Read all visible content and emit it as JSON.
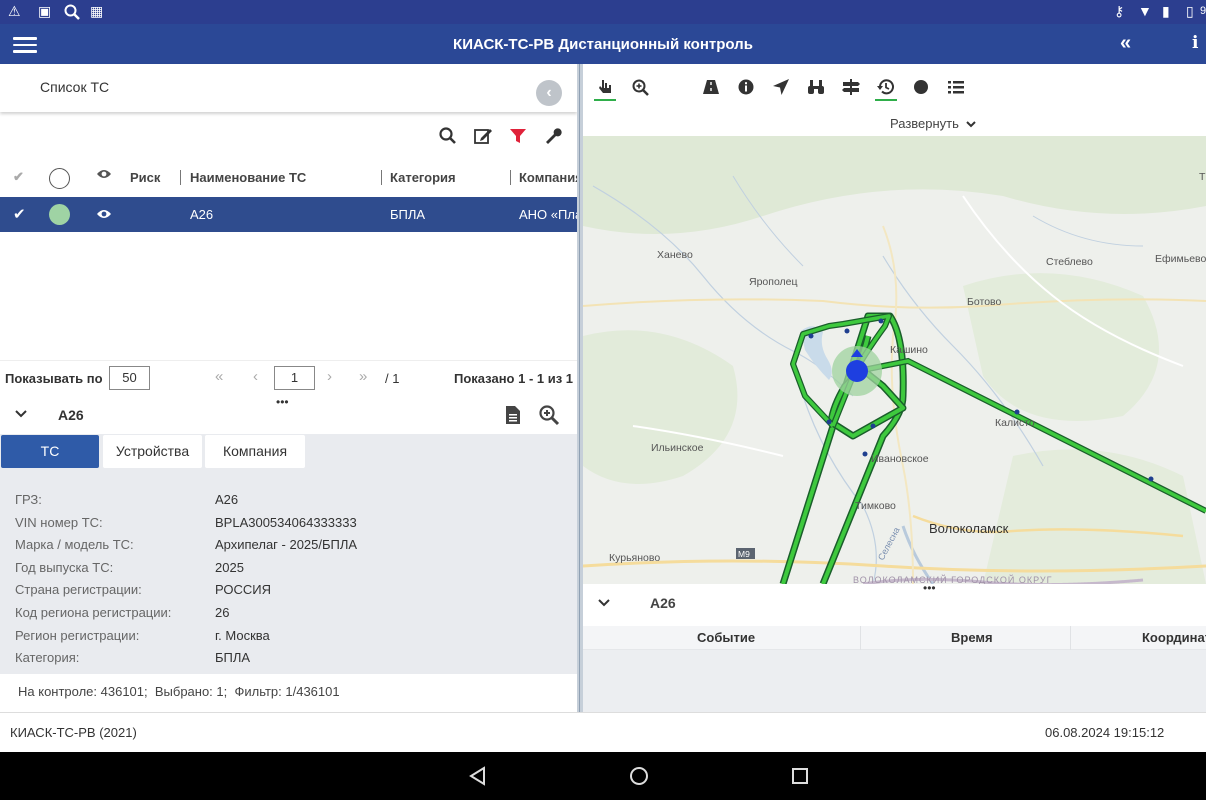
{
  "app": {
    "title": "КИАСК-ТС-РВ Дистанционный контроль",
    "colors": {
      "header": "#2b4896",
      "selected_row": "#2f4c8e",
      "accent_green": "#2fae4a",
      "filter_red": "#e0223a"
    }
  },
  "list": {
    "title": "Список ТС",
    "columns": [
      "Риск",
      "Наименование ТС",
      "Категория",
      "Компания"
    ],
    "rows": [
      {
        "name": "А26",
        "category": "БПЛА",
        "company": "АНО «Пла"
      }
    ],
    "pager": {
      "show_label": "Показывать по",
      "page_size": "50",
      "page": "1",
      "of": "/ 1",
      "shown": "Показано 1 - 1 из 1"
    }
  },
  "detail": {
    "title": "А26",
    "more": "•••",
    "tabs": [
      "ТС",
      "Устройства",
      "Компания"
    ],
    "props": [
      {
        "label": "ГРЗ:",
        "value": "А26"
      },
      {
        "label": "VIN номер ТС:",
        "value": "BPLA300534064333333"
      },
      {
        "label": "Марка / модель ТС:",
        "value": "Архипелаг - 2025/БПЛА"
      },
      {
        "label": "Год выпуска ТС:",
        "value": "2025"
      },
      {
        "label": "Страна регистрации:",
        "value": "РОССИЯ"
      },
      {
        "label": "Код региона регистрации:",
        "value": "26"
      },
      {
        "label": "Регион регистрации:",
        "value": "г. Москва"
      },
      {
        "label": "Категория:",
        "value": "БПЛА"
      }
    ],
    "summary": "На контроле: 436101;  Выбрано: 1;  Фильтр: 1/436101"
  },
  "map": {
    "expand_label": "Развернуть",
    "labels": [
      "Ханево",
      "Ярополец",
      "Стеблево",
      "Ефимьево",
      "Ботово",
      "Кашино",
      "Калисто",
      "Ильинское",
      "Ивановское",
      "Тимково",
      "Волоколамск",
      "Курьяново",
      "М9",
      "Селесна",
      "ВОЛОКОЛАМСКИЙ ГОРОДСКОЙ ОКРУГ",
      "Т"
    ]
  },
  "events": {
    "title": "А26",
    "more": "•••",
    "columns": [
      "Событие",
      "Время",
      "Координат"
    ]
  },
  "footer": {
    "left": "КИАСК-ТС-РВ (2021)",
    "right": "06.08.2024 19:15:12"
  },
  "statusbar": {
    "battery": "9"
  }
}
